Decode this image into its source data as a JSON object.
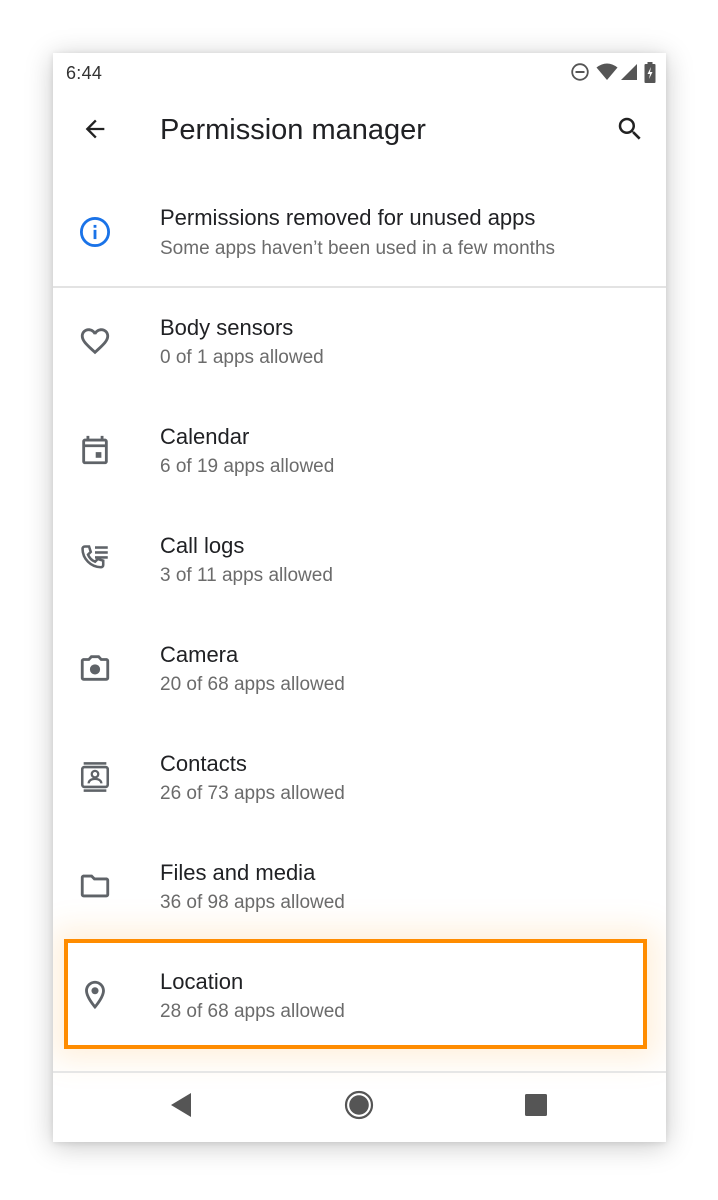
{
  "status_bar": {
    "time": "6:44",
    "icons": [
      "do-not-disturb-icon",
      "wifi-icon",
      "signal-icon",
      "battery-charging-icon"
    ]
  },
  "app_bar": {
    "title": "Permission manager",
    "back_icon": "arrow-back-icon",
    "search_icon": "search-icon"
  },
  "banner": {
    "title": "Permissions removed for unused apps",
    "subtitle": "Some apps haven’t been used in a few months",
    "icon": "info-icon",
    "icon_color": "#1a73e8"
  },
  "permissions": [
    {
      "title": "Body sensors",
      "subtitle": "0 of 1 apps allowed",
      "icon": "heart-icon"
    },
    {
      "title": "Calendar",
      "subtitle": "6 of 19 apps allowed",
      "icon": "calendar-icon"
    },
    {
      "title": "Call logs",
      "subtitle": "3 of 11 apps allowed",
      "icon": "call-log-icon"
    },
    {
      "title": "Camera",
      "subtitle": "20 of 68 apps allowed",
      "icon": "camera-icon"
    },
    {
      "title": "Contacts",
      "subtitle": "26 of 73 apps allowed",
      "icon": "contacts-icon"
    },
    {
      "title": "Files and media",
      "subtitle": "36 of 98 apps allowed",
      "icon": "folder-icon"
    },
    {
      "title": "Location",
      "subtitle": "28 of 68 apps allowed",
      "icon": "location-pin-icon",
      "highlighted": true
    }
  ],
  "highlight_color": "#ff8c00",
  "nav_bar": {
    "icons": [
      "nav-back-icon",
      "nav-home-icon",
      "nav-recents-icon"
    ]
  }
}
